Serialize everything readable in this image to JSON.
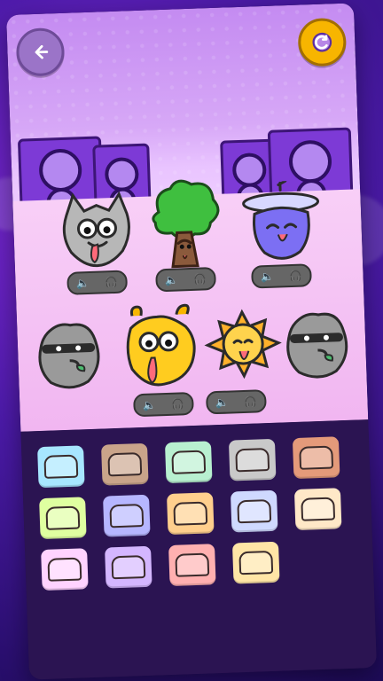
{
  "screen": {
    "title": "",
    "buttons": {
      "back_icon": "arrow-left-icon",
      "reset_icon": "refresh-icon"
    },
    "stage": {
      "characters": [
        {
          "name": "gray-cat",
          "icon": "cat-monster-icon"
        },
        {
          "name": "tree",
          "icon": "tree-monster-icon"
        },
        {
          "name": "satellite-blob",
          "icon": "satellite-blob-icon"
        },
        {
          "name": "ninja-blob-left",
          "icon": "ninja-blob-icon"
        },
        {
          "name": "yellow-bug",
          "icon": "yellow-antenna-icon"
        },
        {
          "name": "sun",
          "icon": "sun-icon"
        },
        {
          "name": "ninja-blob-right",
          "icon": "ninja-blob-icon"
        }
      ],
      "controls": [
        {
          "sound_icon": "speaker-icon",
          "headphones_icon": "headphones-icon"
        },
        {
          "sound_icon": "speaker-icon",
          "headphones_icon": "headphones-icon"
        },
        {
          "sound_icon": "speaker-icon",
          "headphones_icon": "headphones-icon"
        },
        {
          "sound_icon": "speaker-icon",
          "headphones_icon": "headphones-icon"
        },
        {
          "sound_icon": "speaker-icon",
          "headphones_icon": "headphones-icon"
        }
      ]
    },
    "tray": {
      "items": [
        {
          "color": "#a7e6ff",
          "icon": "cloud-hat-icon"
        },
        {
          "color": "#c9a48a",
          "icon": "rock-hat-icon"
        },
        {
          "color": "#b8f0d0",
          "icon": "leaf-hat-icon"
        },
        {
          "color": "#c9c9c9",
          "icon": "cat-ears-hat-icon"
        },
        {
          "color": "#e49a7a",
          "icon": "bowler-hat-icon"
        },
        {
          "color": "#dfffa0",
          "icon": "grass-hat-icon"
        },
        {
          "color": "#b6b6ff",
          "icon": "blue-cap-icon"
        },
        {
          "color": "#ffcf8d",
          "icon": "crab-hat-icon"
        },
        {
          "color": "#cfd9ff",
          "icon": "propeller-cap-icon"
        },
        {
          "color": "#ffe8c7",
          "icon": "headband-icon"
        },
        {
          "color": "#ffd3ff",
          "icon": "bow-hat-icon"
        },
        {
          "color": "#d4b6ff",
          "icon": "purple-horns-icon"
        },
        {
          "color": "#ffb0b0",
          "icon": "red-crown-icon"
        },
        {
          "color": "#ffe5a6",
          "icon": "robot-visor-icon"
        }
      ]
    }
  }
}
